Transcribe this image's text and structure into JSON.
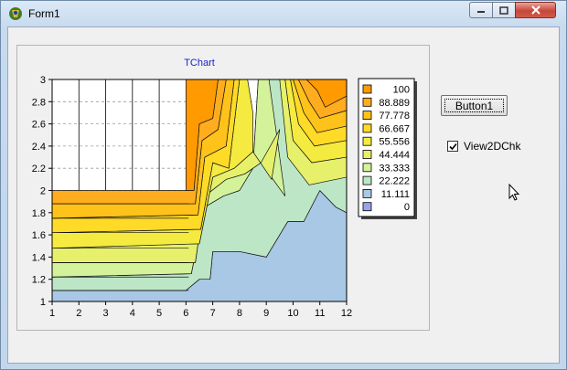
{
  "window": {
    "title": "Form1"
  },
  "title_buttons": {
    "minimize": "minimize",
    "maximize": "maximize",
    "close": "close"
  },
  "button1": {
    "label": "Button1"
  },
  "checkbox": {
    "label": "View2DChk",
    "checked": true
  },
  "chart_data": {
    "type": "heatmap",
    "title": "TChart",
    "xlabel": "",
    "ylabel": "",
    "x_ticks": [
      "1",
      "2",
      "3",
      "4",
      "5",
      "6",
      "7",
      "8",
      "9",
      "10",
      "11",
      "12"
    ],
    "y_ticks": [
      "1",
      "1.2",
      "1.4",
      "1.6",
      "1.8",
      "2",
      "2.2",
      "2.4",
      "2.6",
      "2.8",
      "3"
    ],
    "xlim": [
      1,
      12
    ],
    "ylim": [
      1,
      3
    ],
    "legend": {
      "placement": "right",
      "entries": [
        {
          "label": "100",
          "color": "#ff9a00"
        },
        {
          "label": "88.889",
          "color": "#ffad1f"
        },
        {
          "label": "77.778",
          "color": "#ffc21a"
        },
        {
          "label": "66.667",
          "color": "#ffdb27"
        },
        {
          "label": "55.556",
          "color": "#f5ea40"
        },
        {
          "label": "44.444",
          "color": "#e6f06a"
        },
        {
          "label": "33.333",
          "color": "#d3f29a"
        },
        {
          "label": "22.222",
          "color": "#bde6c6"
        },
        {
          "label": "11.111",
          "color": "#a9c8e5"
        },
        {
          "label": "0",
          "color": "#9aa4ec"
        }
      ]
    },
    "grid": true
  }
}
